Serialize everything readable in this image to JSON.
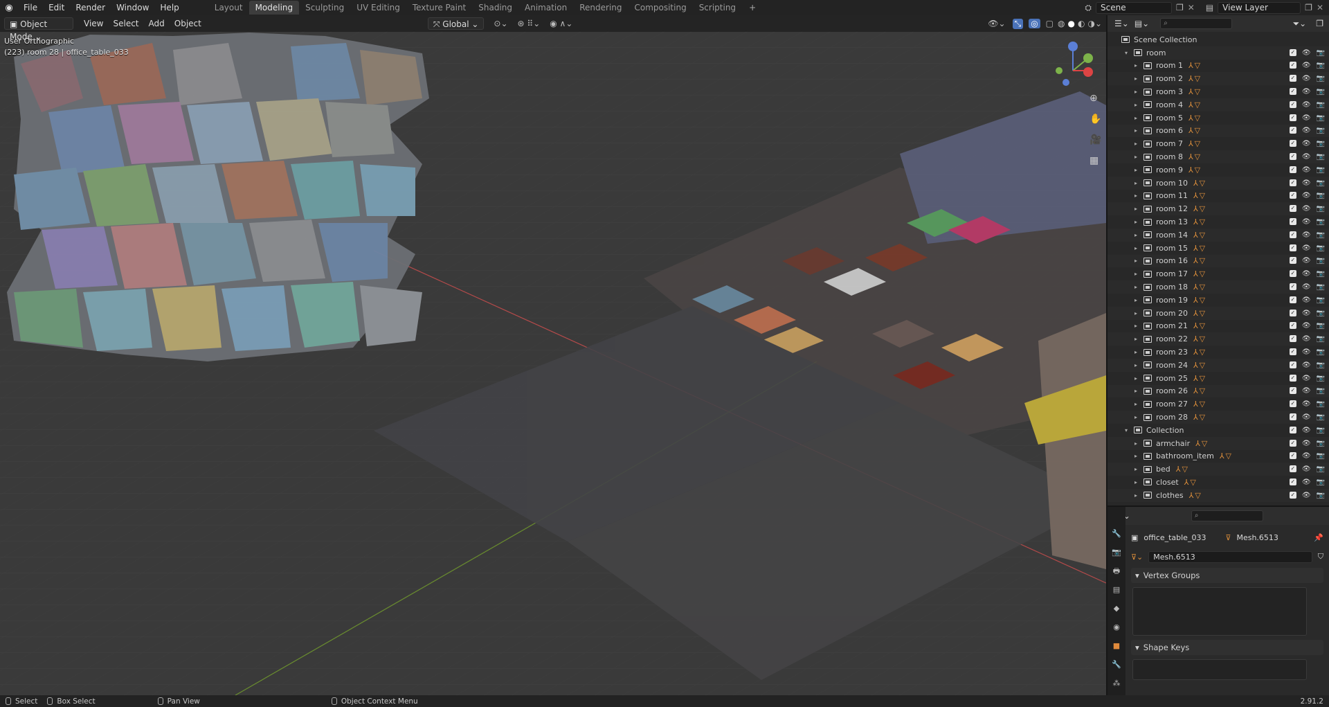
{
  "menu": [
    "File",
    "Edit",
    "Render",
    "Window",
    "Help"
  ],
  "workspaces": [
    "Layout",
    "Modeling",
    "Sculpting",
    "UV Editing",
    "Texture Paint",
    "Shading",
    "Animation",
    "Rendering",
    "Compositing",
    "Scripting"
  ],
  "active_workspace": "Modeling",
  "scene": "Scene",
  "view_layer": "View Layer",
  "viewport": {
    "mode": "Object Mode",
    "menus": [
      "View",
      "Select",
      "Add",
      "Object"
    ],
    "transform": "Global",
    "info_line1": "User Orthographic",
    "info_line2": "(223) room 28 | office_table_033"
  },
  "outliner": {
    "scene_collection": "Scene Collection",
    "rows": [
      {
        "label": "room",
        "level": 1,
        "open": true
      },
      {
        "label": "room 1",
        "level": 2
      },
      {
        "label": "room 2",
        "level": 2
      },
      {
        "label": "room 3",
        "level": 2
      },
      {
        "label": "room 4",
        "level": 2
      },
      {
        "label": "room 5",
        "level": 2
      },
      {
        "label": "room 6",
        "level": 2
      },
      {
        "label": "room 7",
        "level": 2
      },
      {
        "label": "room 8",
        "level": 2
      },
      {
        "label": "room 9",
        "level": 2
      },
      {
        "label": "room 10",
        "level": 2
      },
      {
        "label": "room 11",
        "level": 2
      },
      {
        "label": "room 12",
        "level": 2
      },
      {
        "label": "room 13",
        "level": 2
      },
      {
        "label": "room 14",
        "level": 2
      },
      {
        "label": "room 15",
        "level": 2
      },
      {
        "label": "room 16",
        "level": 2
      },
      {
        "label": "room 17",
        "level": 2
      },
      {
        "label": "room 18",
        "level": 2
      },
      {
        "label": "room 19",
        "level": 2
      },
      {
        "label": "room 20",
        "level": 2
      },
      {
        "label": "room 21",
        "level": 2
      },
      {
        "label": "room 22",
        "level": 2
      },
      {
        "label": "room 23",
        "level": 2
      },
      {
        "label": "room 24",
        "level": 2
      },
      {
        "label": "room 25",
        "level": 2
      },
      {
        "label": "room 26",
        "level": 2
      },
      {
        "label": "room 27",
        "level": 2
      },
      {
        "label": "room 28",
        "level": 2
      },
      {
        "label": "Collection",
        "level": 1,
        "open": true
      },
      {
        "label": "armchair",
        "level": 2
      },
      {
        "label": "bathroom_item",
        "level": 2
      },
      {
        "label": "bed",
        "level": 2
      },
      {
        "label": "closet",
        "level": 2
      },
      {
        "label": "clothes",
        "level": 2
      }
    ]
  },
  "properties": {
    "object_name": "office_table_033",
    "mesh_name": "Mesh.6513",
    "data_field": "Mesh.6513",
    "panels": [
      "Vertex Groups",
      "Shape Keys"
    ]
  },
  "statusbar": {
    "select": "Select",
    "box_select": "Box Select",
    "pan_view": "Pan View",
    "context_menu": "Object Context Menu",
    "version": "2.91.2"
  }
}
